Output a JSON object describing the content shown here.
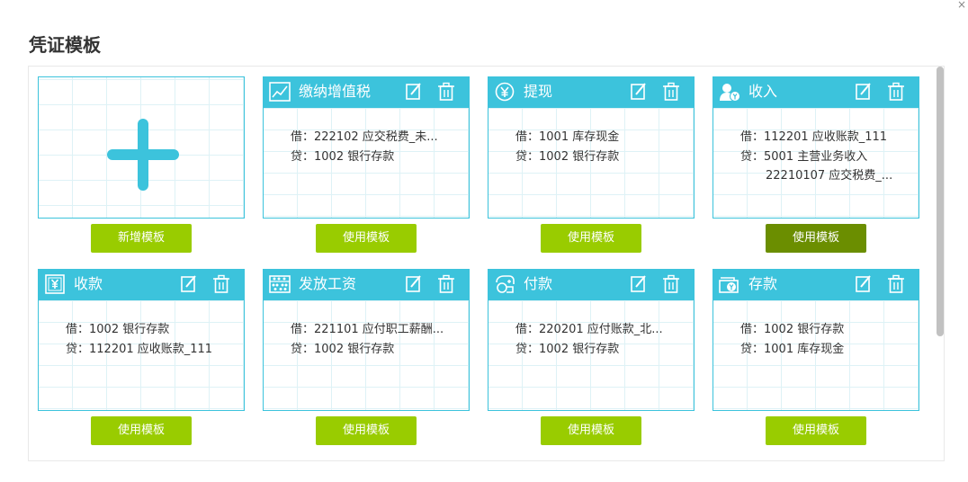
{
  "dialog": {
    "title": "凭证模板",
    "close_label": "×"
  },
  "add_card": {
    "button_label": "新增模板"
  },
  "cards": [
    {
      "title": "缴纳增值税",
      "debit": "借：222102 应交税费_未...",
      "credit": "贷：1002 银行存款",
      "extra": "",
      "button_label": "使用模板"
    },
    {
      "title": "提现",
      "debit": "借：1001 库存现金",
      "credit": "贷：1002 银行存款",
      "extra": "",
      "button_label": "使用模板"
    },
    {
      "title": "收入",
      "debit": "借：112201 应收账款_111",
      "credit": "贷：5001 主营业务收入",
      "extra": "22210107 应交税费_...",
      "button_label": "使用模板"
    },
    {
      "title": "收款",
      "debit": "借：1002 银行存款",
      "credit": "贷：112201 应收账款_111",
      "extra": "",
      "button_label": "使用模板"
    },
    {
      "title": "发放工资",
      "debit": "借：221101 应付职工薪酬...",
      "credit": "贷：1002 银行存款",
      "extra": "",
      "button_label": "使用模板"
    },
    {
      "title": "付款",
      "debit": "借：220201 应付账款_北...",
      "credit": "贷：1002 银行存款",
      "extra": "",
      "button_label": "使用模板"
    },
    {
      "title": "存款",
      "debit": "借：1002 银行存款",
      "credit": "贷：1001 库存现金",
      "extra": "",
      "button_label": "使用模板"
    }
  ],
  "icons": [
    "chart-line-icon",
    "yuan-coin-icon",
    "user-yuan-icon",
    "yuan-receipt-icon",
    "abacus-icon",
    "payment-hands-icon",
    "wallet-deposit-icon"
  ],
  "colors": {
    "header": "#3cc3dc",
    "button": "#99cc00",
    "button_active": "#6b8e00",
    "grid": "#def2f6"
  }
}
